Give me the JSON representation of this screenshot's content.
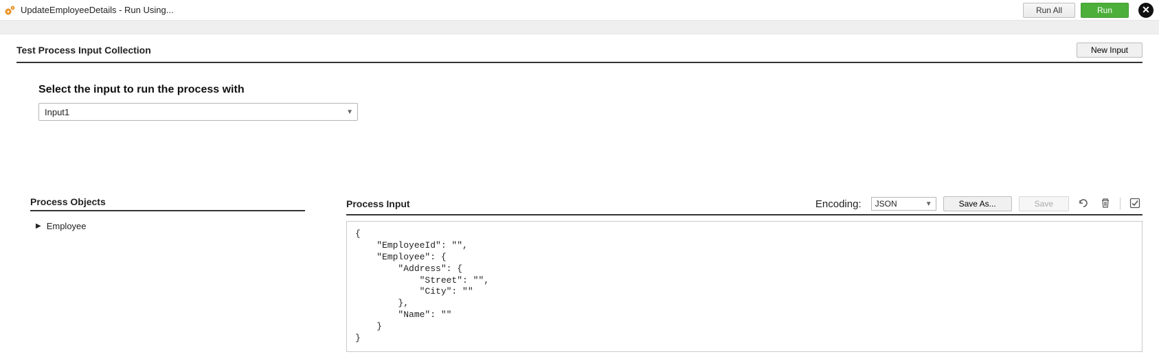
{
  "header": {
    "title": "UpdateEmployeeDetails - Run Using...",
    "run_all_label": "Run All",
    "run_label": "Run"
  },
  "collection": {
    "title": "Test Process Input Collection",
    "new_input_label": "New Input"
  },
  "input_select": {
    "label": "Select the input to run the process with",
    "selected": "Input1"
  },
  "process_objects": {
    "title": "Process Objects",
    "items": [
      {
        "label": "Employee"
      }
    ]
  },
  "process_input": {
    "title": "Process Input",
    "encoding_label": "Encoding:",
    "encoding_value": "JSON",
    "save_as_label": "Save As...",
    "save_label": "Save",
    "json_text": "{\n    \"EmployeeId\": \"\",\n    \"Employee\": {\n        \"Address\": {\n            \"Street\": \"\",\n            \"City\": \"\"\n        },\n        \"Name\": \"\"\n    }\n}"
  }
}
